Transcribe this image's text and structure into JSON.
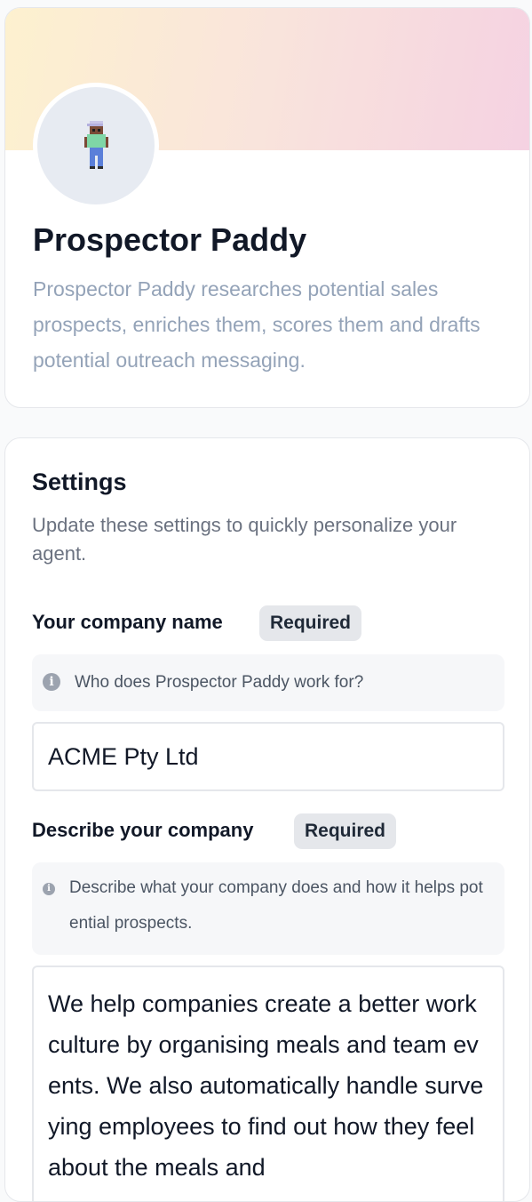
{
  "agent": {
    "name": "Prospector Paddy",
    "description": "Prospector Paddy researches potential sales prospects, enriches them, scores them and drafts potential outreach messaging.",
    "avatar_icon": "pixel-character-avatar"
  },
  "settings": {
    "title": "Settings",
    "subtitle": "Update these settings to quickly personalize your agent.",
    "fields": [
      {
        "label": "Your company name",
        "badge": "Required",
        "hint": "Who does Prospector Paddy work for?",
        "value": "ACME Pty Ltd"
      },
      {
        "label": "Describe your company",
        "badge": "Required",
        "hint": "Describe what your company does and how it helps potential prospects.",
        "value": "We help companies create a better work culture by organising meals and team events. We also automatically handle surveying employees to find out how they feel about the meals and"
      }
    ]
  },
  "colors": {
    "banner_start": "#fdf1cf",
    "banner_end": "#f5d2e2",
    "muted_text": "#94a3b8",
    "badge_bg": "#e5e7eb"
  }
}
